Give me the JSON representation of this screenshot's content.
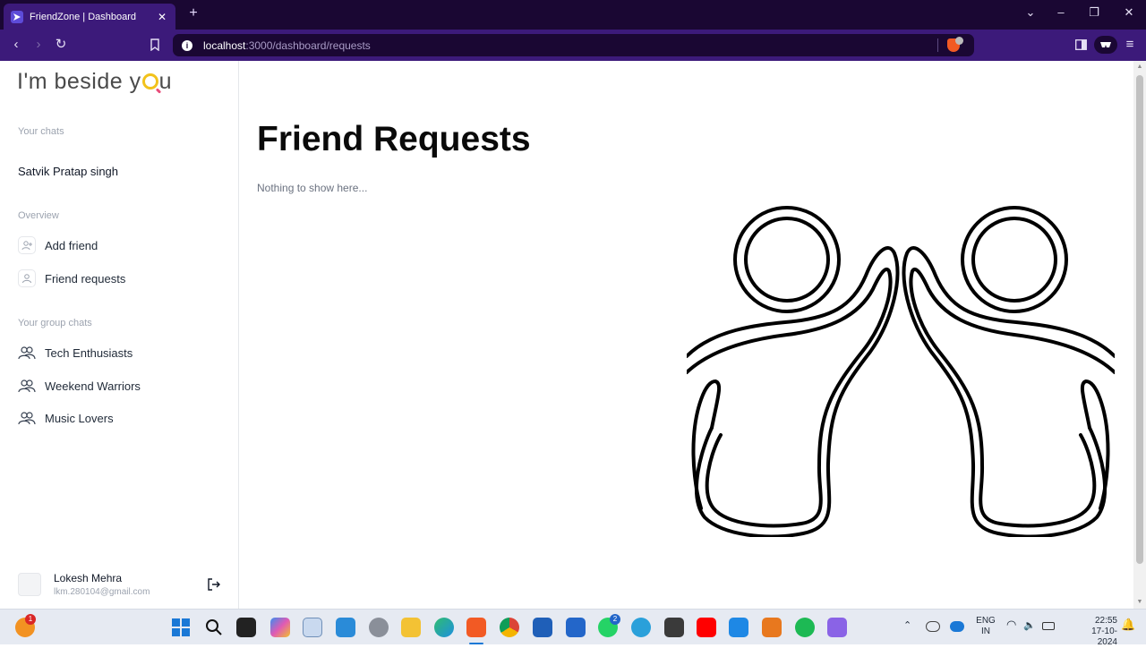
{
  "browser": {
    "tab_title": "FriendZone | Dashboard",
    "url_host": "localhost",
    "url_path": ":3000/dashboard/requests"
  },
  "sidebar": {
    "logo": "I'm beside you",
    "chats_label": "Your chats",
    "chats": [
      "Satvik Pratap singh"
    ],
    "overview_label": "Overview",
    "overview_items": [
      "Add friend",
      "Friend requests"
    ],
    "groups_label": "Your group chats",
    "groups": [
      "Tech Enthusiasts",
      "Weekend Warriors",
      "Music Lovers"
    ],
    "user": {
      "name": "Lokesh Mehra",
      "email": "lkm.280104@gmail.com"
    }
  },
  "main": {
    "title": "Friend Requests",
    "empty_text": "Nothing to show here..."
  },
  "taskbar": {
    "badge_left": "1",
    "badge_app": "2",
    "lang_line1": "ENG",
    "lang_line2": "IN",
    "time": "22:55",
    "date": "17-10-2024"
  },
  "colors": {
    "titlebar": "#1a0733",
    "toolbar": "#3c1a7a",
    "accent_brave": "#f25a24"
  }
}
